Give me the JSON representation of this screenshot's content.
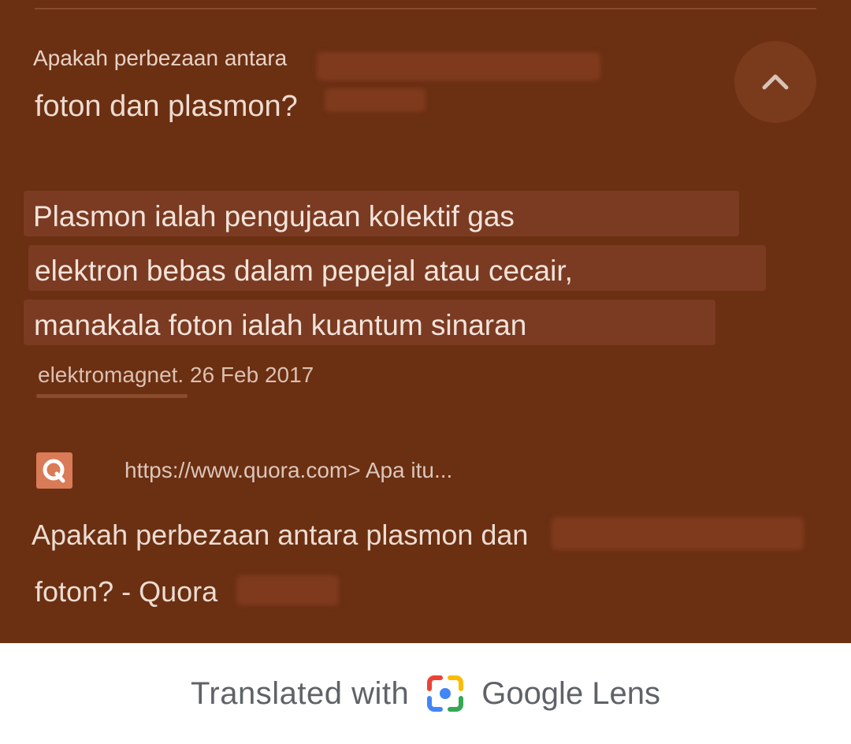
{
  "question": {
    "line1": "Apakah perbezaan antara",
    "line2": "foton dan plasmon?"
  },
  "answer": {
    "lines": [
      "Plasmon ialah pengujaan kolektif gas",
      "elektron bebas dalam pepejal atau cecair,",
      "manakala foton ialah kuantum sinaran"
    ],
    "source": "elektromagnet. 26 Feb 2017"
  },
  "result": {
    "url": "https://www.quora.com> Apa itu...",
    "title_line1": "Apakah perbezaan antara plasmon dan",
    "title_line2": "foton? - Quora"
  },
  "footer": {
    "translated_with": "Translated with",
    "brand": "Google Lens"
  },
  "icons": {
    "collapse": "chevron-up-icon",
    "site": "quora-icon",
    "lens": "google-lens-icon"
  },
  "colors": {
    "background": "#6b2f12",
    "highlight": "#7a3b22",
    "footer_bg": "#ffffff"
  }
}
